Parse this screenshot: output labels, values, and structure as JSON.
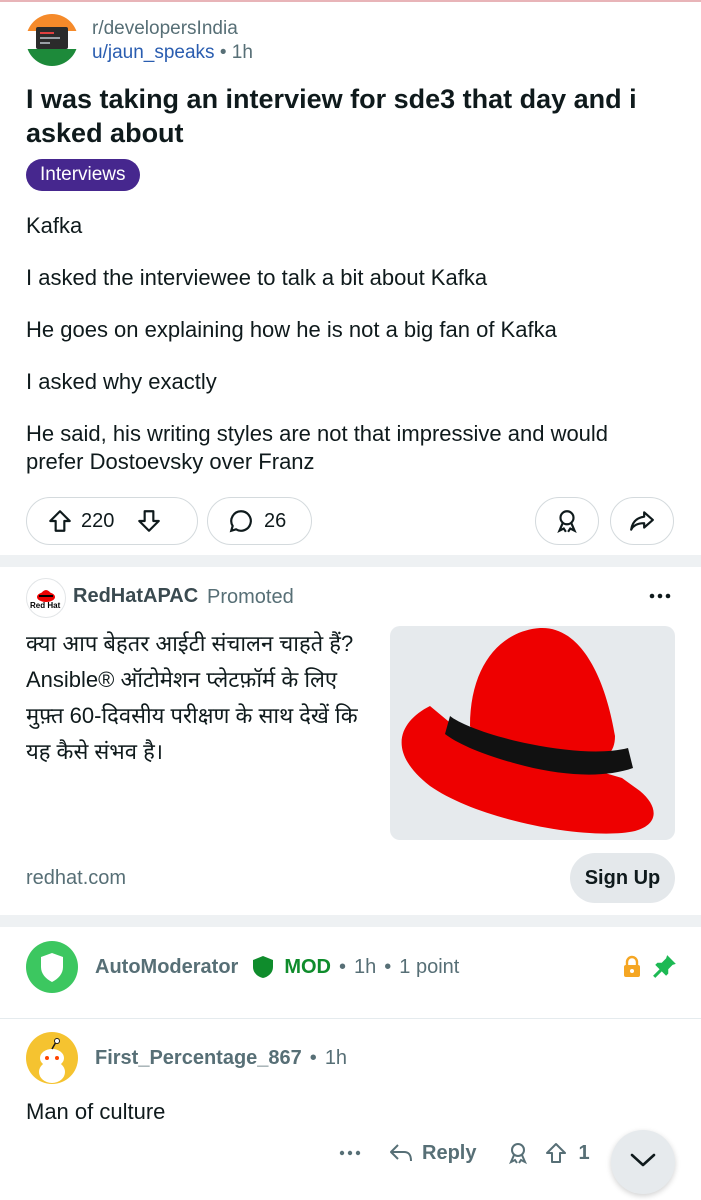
{
  "post": {
    "subreddit": "r/developersIndia",
    "author": "u/jaun_speaks",
    "age": "1h",
    "title": "I was taking an interview for sde3 that day and i asked about",
    "flair": "Interviews",
    "body": [
      "Kafka",
      "I asked the interviewee to talk a bit about Kafka",
      "He goes on explaining how he is not a big fan of Kafka",
      "I asked why exactly",
      "He said, his writing styles are not that impressive and would prefer Dostoevsky over Franz"
    ],
    "upvotes": "220",
    "comments": "26"
  },
  "ad": {
    "logo_text": "Red Hat",
    "advertiser": "RedHatAPAC",
    "promoted_label": "Promoted",
    "text": "क्या आप बेहतर आईटी संचालन चाहते हैं? Ansible® ऑटोमेशन प्लेटफ़ॉर्म के लिए मुफ़्त 60-दिवसीय परीक्षण के साथ देखें कि यह कैसे संभव है।",
    "domain": "redhat.com",
    "cta": "Sign Up"
  },
  "comments": [
    {
      "username": "AutoModerator",
      "tag": "MOD",
      "age": "1h",
      "points": "1 point",
      "icons": [
        "shield-icon",
        "lock-icon",
        "pin-icon"
      ]
    },
    {
      "username": "First_Percentage_867",
      "age": "1h",
      "text": "Man of culture",
      "reply_label": "Reply",
      "upvotes_visible": "1"
    }
  ],
  "colors": {
    "flair_bg": "#46278e",
    "link_blue": "#2a5db0",
    "mod_green": "#0f8c2c",
    "redhat_red": "#ee0000"
  }
}
